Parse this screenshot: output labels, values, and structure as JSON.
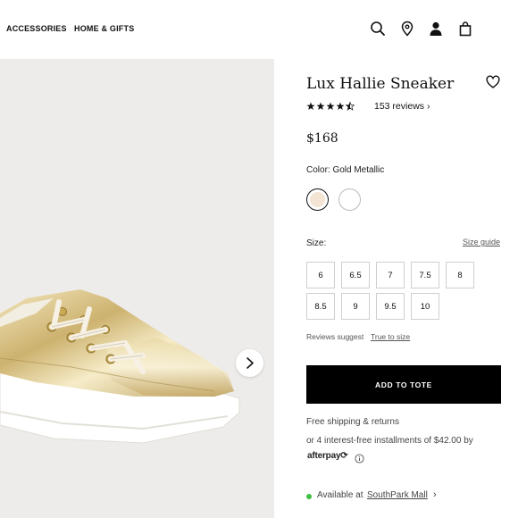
{
  "nav": {
    "links": [
      "ACCESSORIES",
      "HOME & GIFTS"
    ],
    "icons": [
      "search-icon",
      "location-pin-icon",
      "account-icon",
      "shopping-bag-icon"
    ]
  },
  "gallery": {
    "next_icon": "chevron-right-icon"
  },
  "product": {
    "title": "Lux Hallie Sneaker",
    "rating": 4.5,
    "rating_max": 5,
    "reviews_label": "153 reviews ›",
    "price": "$168",
    "color_label": "Color: Gold Metallic",
    "swatches": [
      {
        "name": "Gold Metallic",
        "color": "#f3e4d3",
        "selected": true
      },
      {
        "name": "White",
        "color": "#ffffff",
        "selected": false
      }
    ],
    "size_label": "Size:",
    "size_guide": "Size guide",
    "sizes": [
      "6",
      "6.5",
      "7",
      "7.5",
      "8",
      "8.5",
      "9",
      "9.5",
      "10"
    ],
    "fit_label": "Reviews suggest",
    "fit_value": "True to size",
    "add_to_tote": "ADD TO TOTE",
    "shipping": "Free shipping & returns",
    "installments": "or 4 interest-free installments of $42.00 by",
    "afterpay": "afterpay⟳",
    "availability_prefix": "Available at",
    "availability_store": "SouthPark Mall",
    "availability_chevron": "›"
  },
  "colors": {
    "accent": "#000000",
    "available": "#3fbf3f",
    "image_bg": "#eeecea",
    "shoe_gold": "#d9c48e"
  }
}
